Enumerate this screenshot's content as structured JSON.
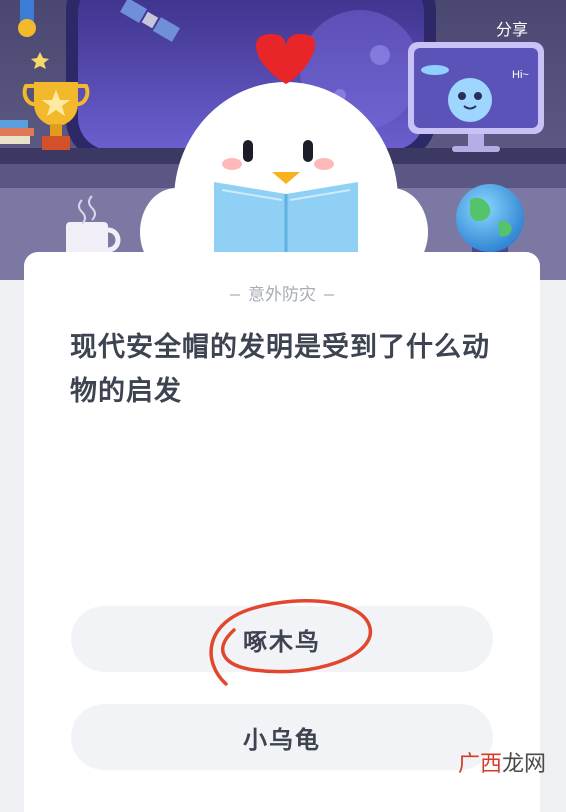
{
  "header": {
    "share_label": "分享"
  },
  "hero": {
    "screen_greeting": "Hi~",
    "colors": {
      "sky": "#4a3f8f",
      "accent": "#7a6ae0"
    },
    "icons": [
      "satellite-icon",
      "trophy-icon",
      "ufo-icon",
      "globe-icon",
      "mug-icon",
      "chicken-mascot"
    ]
  },
  "quiz": {
    "category": "意外防灾",
    "question_line1": "现代安全帽的发明是受到了什么动",
    "question_line2": "物的启发",
    "options": [
      {
        "label": "啄木鸟",
        "circled": true
      },
      {
        "label": "小乌龟",
        "circled": false
      }
    ]
  },
  "watermark": {
    "part1": "广西",
    "part2": "龙网"
  }
}
